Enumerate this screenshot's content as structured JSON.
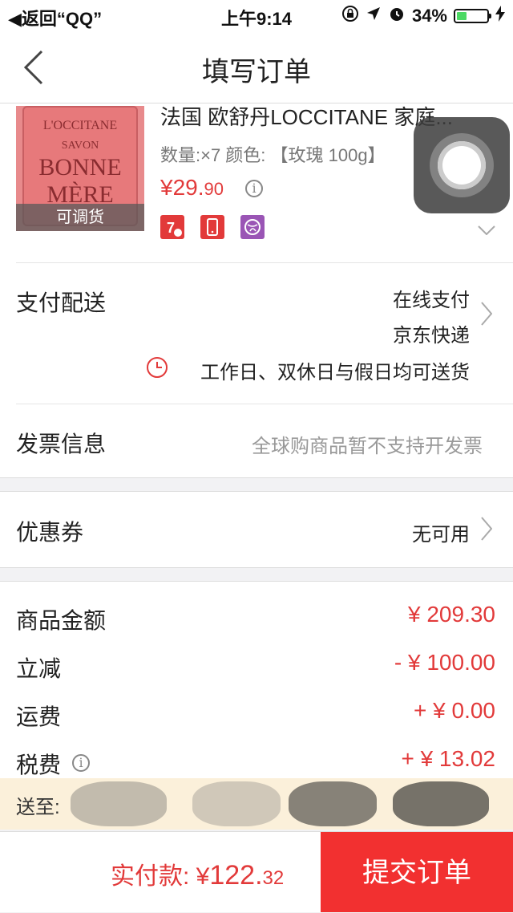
{
  "status_bar": {
    "back_app": "返回“QQ”",
    "time": "上午9:14",
    "battery": "34%",
    "battery_level": 0.34
  },
  "nav": {
    "title": "填写订单"
  },
  "product": {
    "title": "法国 欧舒丹LOCCITANE 家庭...",
    "meta": "数量:×7   颜色: 【玫瑰 100g】",
    "price_main": "¥29.",
    "price_cents": "90",
    "overlay": "可调货",
    "soap_text": {
      "brand": "L'OCCITANE",
      "line1": "SAVON",
      "line2": "BONNE",
      "line3": "MÈRE"
    }
  },
  "payment": {
    "label": "支付配送",
    "method": "在线支付",
    "shipping": "京东快递",
    "delivery_time": "工作日、双休日与假日均可送货"
  },
  "invoice": {
    "label": "发票信息",
    "value": "全球购商品暂不支持开发票"
  },
  "coupon": {
    "label": "优惠券",
    "value": "无可用"
  },
  "summary": {
    "items": [
      {
        "label": "商品金额",
        "value": "¥ 209.30"
      },
      {
        "label": "立减",
        "value": "-  ¥ 100.00"
      },
      {
        "label": "运费",
        "value": "+  ¥ 0.00"
      },
      {
        "label": "税费",
        "value": "+  ¥ 13.02"
      }
    ]
  },
  "address": {
    "label": "送至:"
  },
  "bottom_bar": {
    "total_label": "实付款: ¥",
    "total_main": "122.",
    "total_cents": "32",
    "submit": "提交订单"
  },
  "colors": {
    "accent_red": "#e23a3a",
    "submit_bg": "#f23030",
    "address_bg": "#fbf0da"
  }
}
